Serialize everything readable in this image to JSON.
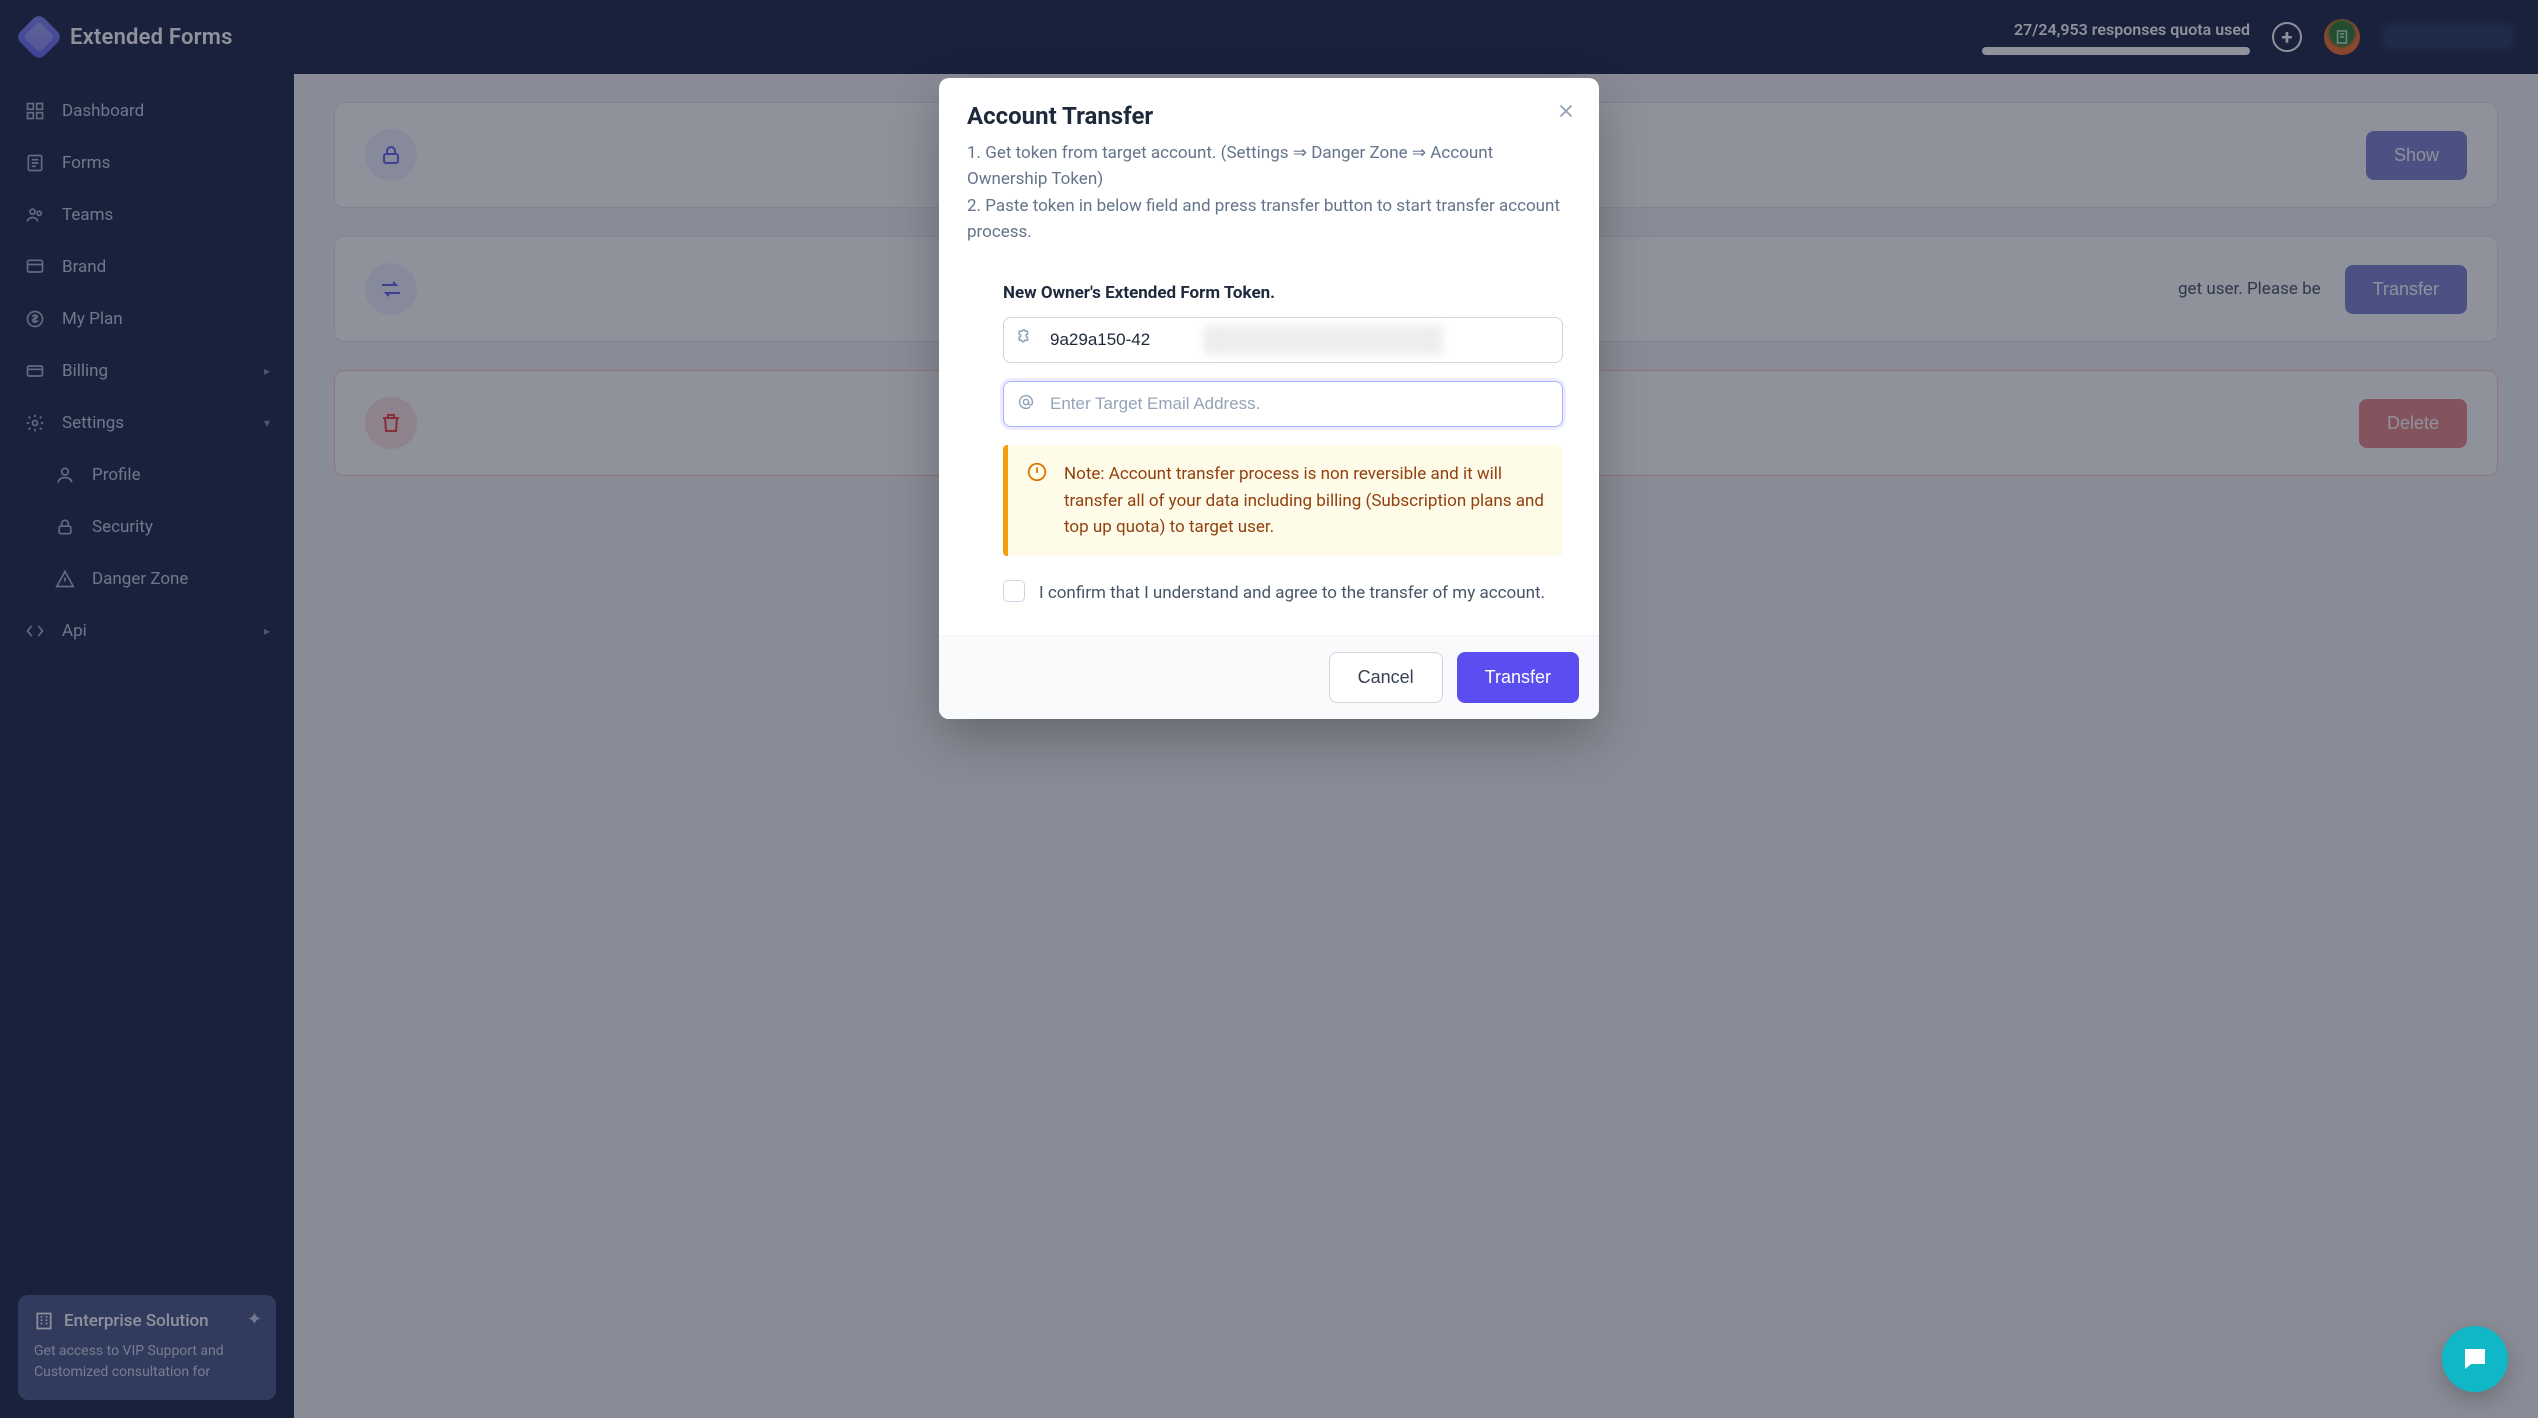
{
  "brand": "Extended Forms",
  "sidebar": {
    "items": [
      {
        "label": "Dashboard"
      },
      {
        "label": "Forms"
      },
      {
        "label": "Teams"
      },
      {
        "label": "Brand"
      },
      {
        "label": "My Plan"
      },
      {
        "label": "Billing"
      },
      {
        "label": "Settings"
      },
      {
        "label": "Profile"
      },
      {
        "label": "Security"
      },
      {
        "label": "Danger Zone"
      },
      {
        "label": "Api"
      }
    ],
    "enterprise": {
      "title": "Enterprise Solution",
      "desc": "Get access to VIP Support and Customized consultation for"
    }
  },
  "topbar": {
    "quota_text": "27/24,953 responses quota used"
  },
  "cards": {
    "show_label": "Show",
    "transfer_label": "Transfer",
    "transfer_body_fragment": "get user. Please be",
    "delete_label": "Delete"
  },
  "modal": {
    "title": "Account Transfer",
    "desc": "1. Get token from target account. (Settings ⇒ Danger Zone ⇒ Account Ownership Token)\n2. Paste token in below field and press transfer button to start transfer account process.",
    "field_label": "New Owner's Extended Form Token.",
    "token_value": "9a29a150-42",
    "email_placeholder": "Enter Target Email Address.",
    "note": "Note: Account transfer process is non reversible and it will transfer all of your data including billing (Subscription plans and top up quota) to target user.",
    "confirm": "I confirm that I understand and agree to the transfer of my account.",
    "cancel": "Cancel",
    "transfer": "Transfer"
  }
}
